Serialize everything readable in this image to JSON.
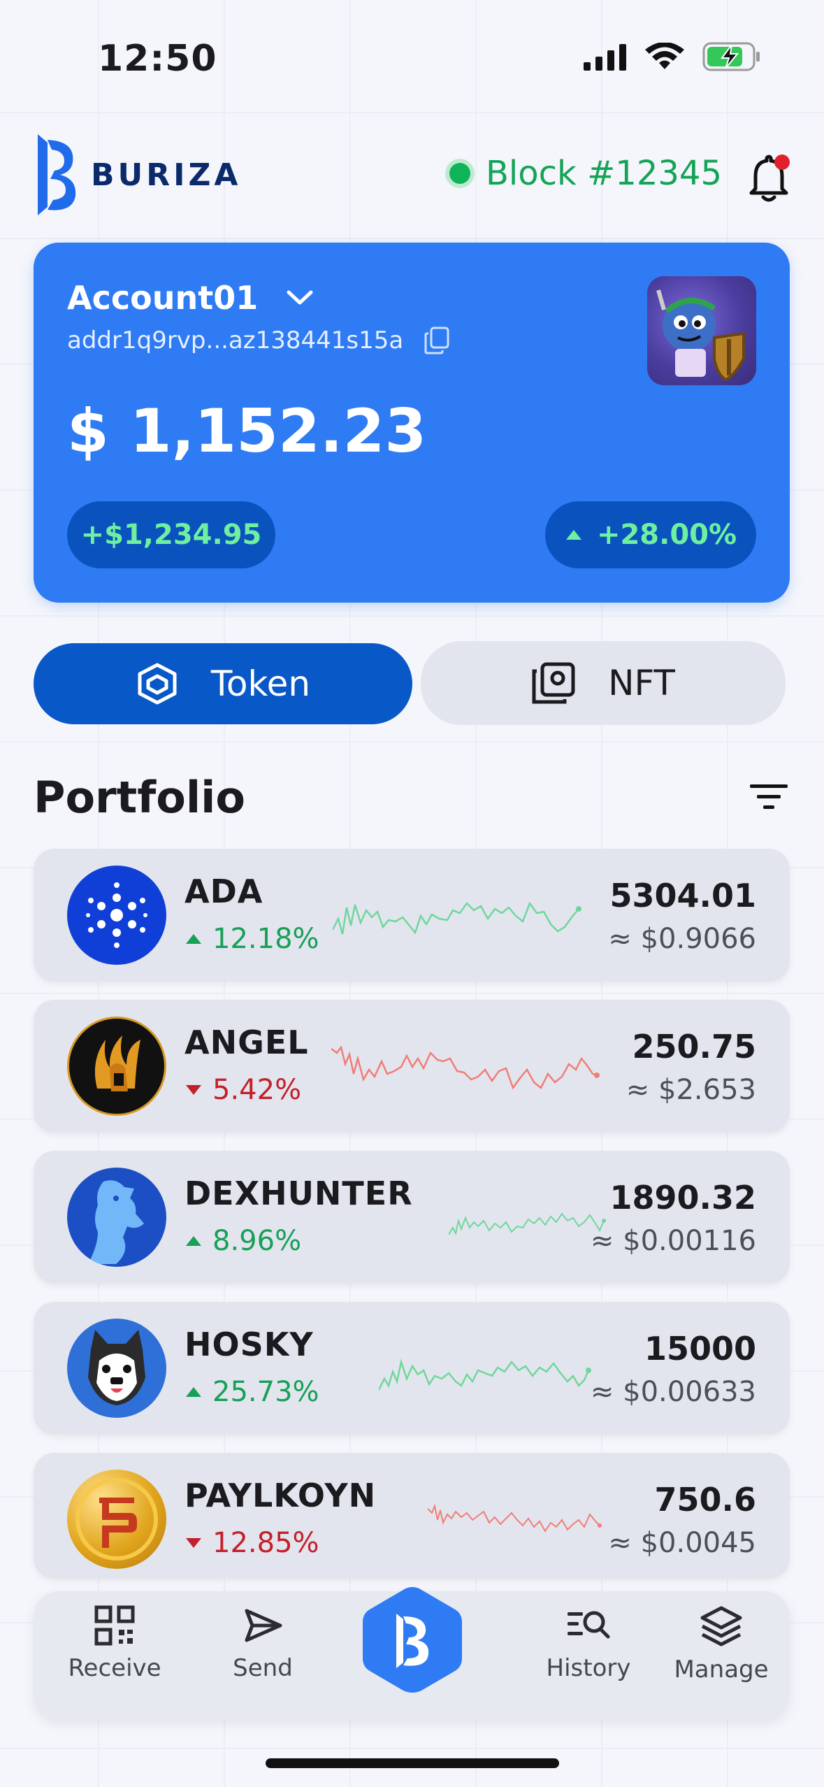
{
  "status_bar": {
    "time": "12:50"
  },
  "header": {
    "brand": "BURIZA",
    "block_label": "Block #12345"
  },
  "account": {
    "name": "Account01",
    "address": "addr1q9rvp...az138441s15a",
    "balance": "$ 1,152.23",
    "change_amount": "+$1,234.95",
    "change_percent": "+28.00%"
  },
  "tabs": {
    "token_label": "Token",
    "nft_label": "NFT"
  },
  "portfolio": {
    "title": "Portfolio",
    "tokens": [
      {
        "name": "ADA",
        "change": "12.18%",
        "direction": "up",
        "amount": "5304.01",
        "value": "≈ $0.9066",
        "color": "#0f3fd6"
      },
      {
        "name": "ANGEL",
        "change": "5.42%",
        "direction": "down",
        "amount": "250.75",
        "value": "≈ $2.653",
        "color": "#111111"
      },
      {
        "name": "DEXHUNTER",
        "change": "8.96%",
        "direction": "up",
        "amount": "1890.32",
        "value": "≈ $0.00116",
        "color": "#1d4fc4"
      },
      {
        "name": "HOSKY",
        "change": "25.73%",
        "direction": "up",
        "amount": "15000",
        "value": "≈ $0.00633",
        "color": "#2f6fd8"
      },
      {
        "name": "PAYLKOYN",
        "change": "12.85%",
        "direction": "down",
        "amount": "750.6",
        "value": "≈ $0.0045",
        "color": "#e0a41c"
      }
    ]
  },
  "nav": {
    "receive": "Receive",
    "send": "Send",
    "history": "History",
    "manage": "Manage"
  },
  "colors": {
    "primary": "#2f7bf3",
    "accent_dark": "#0858c8",
    "up": "#17a058",
    "down": "#c4202a"
  }
}
